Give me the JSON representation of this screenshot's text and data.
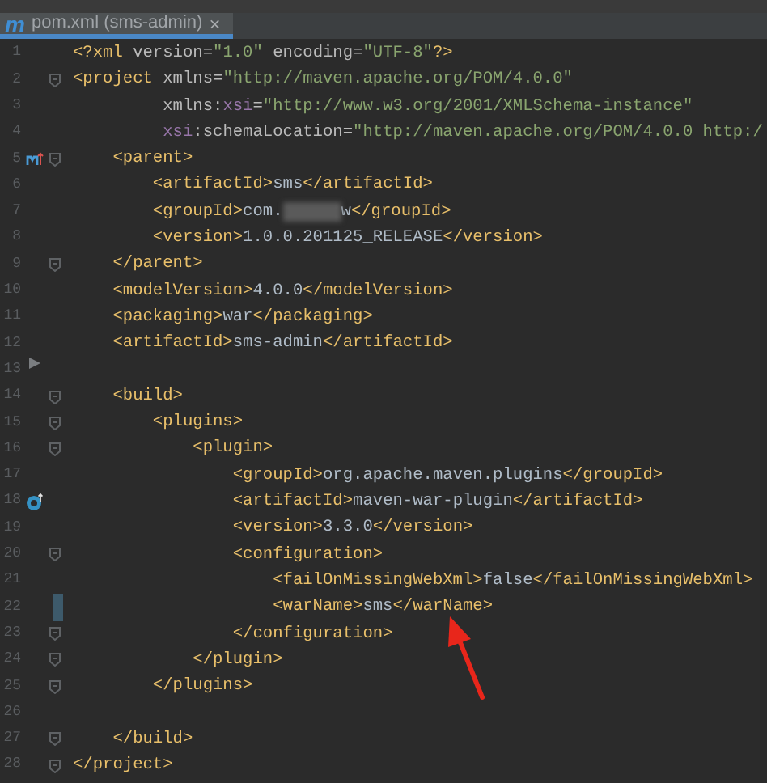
{
  "tab": {
    "icon_letter": "m",
    "title": "pom.xml (sms-admin)",
    "close": "×",
    "selected": true
  },
  "lines": [
    {
      "number": "1",
      "fold": false,
      "tokens": [
        {
          "kind": "tag",
          "text": "<?xml "
        },
        {
          "kind": "attr",
          "text": "version="
        },
        {
          "kind": "value",
          "text": "\"1.0\""
        },
        {
          "kind": "attr",
          "text": " encoding="
        },
        {
          "kind": "value",
          "text": "\"UTF-8\""
        },
        {
          "kind": "tag",
          "text": "?>"
        }
      ]
    },
    {
      "number": "2",
      "fold": true,
      "tokens": [
        {
          "kind": "tag",
          "text": "<project "
        },
        {
          "kind": "attr",
          "text": "xmlns="
        },
        {
          "kind": "value",
          "text": "\"http://maven.apache.org/POM/4.0.0\""
        }
      ]
    },
    {
      "number": "3",
      "fold": false,
      "tokens": [
        {
          "kind": "attr",
          "text": "         xmlns:"
        },
        {
          "kind": "ns",
          "text": "xsi"
        },
        {
          "kind": "attr",
          "text": "="
        },
        {
          "kind": "value",
          "text": "\"http://www.w3.org/2001/XMLSchema-instance\""
        }
      ]
    },
    {
      "number": "4",
      "fold": false,
      "tokens": [
        {
          "kind": "ns",
          "text": "         xsi"
        },
        {
          "kind": "attr",
          "text": ":schemaLocation="
        },
        {
          "kind": "value",
          "text": "\"http://maven.apache.org/POM/4.0.0 http:/"
        }
      ]
    },
    {
      "number": "5",
      "fold": true,
      "gutter_icon": {
        "kind": "maven"
      },
      "tokens": [
        {
          "kind": "tag",
          "text": "    <parent>"
        }
      ]
    },
    {
      "number": "6",
      "fold": false,
      "tokens": [
        {
          "kind": "tag",
          "text": "        <artifactId>"
        },
        {
          "kind": "text",
          "text": "sms"
        },
        {
          "kind": "tag",
          "text": "</artifactId>"
        }
      ]
    },
    {
      "number": "7",
      "fold": false,
      "tokens": [
        {
          "kind": "tag",
          "text": "        <groupId>"
        },
        {
          "kind": "text",
          "text": "com."
        },
        {
          "kind": "redacted"
        },
        {
          "kind": "text",
          "text": "w"
        },
        {
          "kind": "tag",
          "text": "</groupId>"
        }
      ]
    },
    {
      "number": "8",
      "fold": false,
      "tokens": [
        {
          "kind": "tag",
          "text": "        <version>"
        },
        {
          "kind": "text",
          "text": "1.0.0.201125_RELEASE"
        },
        {
          "kind": "tag",
          "text": "</version>"
        }
      ]
    },
    {
      "number": "9",
      "fold": true,
      "tokens": [
        {
          "kind": "tag",
          "text": "    </parent>"
        }
      ]
    },
    {
      "number": "10",
      "fold": false,
      "tokens": [
        {
          "kind": "tag",
          "text": "    <modelVersion>"
        },
        {
          "kind": "text",
          "text": "4.0.0"
        },
        {
          "kind": "tag",
          "text": "</modelVersion>"
        }
      ]
    },
    {
      "number": "11",
      "fold": false,
      "tokens": [
        {
          "kind": "tag",
          "text": "    <packaging>"
        },
        {
          "kind": "text",
          "text": "war"
        },
        {
          "kind": "tag",
          "text": "</packaging>"
        }
      ]
    },
    {
      "number": "12",
      "fold": false,
      "tokens": [
        {
          "kind": "tag",
          "text": "    <artifactId>"
        },
        {
          "kind": "text",
          "text": "sms-admin"
        },
        {
          "kind": "tag",
          "text": "</artifactId>"
        }
      ]
    },
    {
      "number": "13",
      "fold": false,
      "gutter_icon": {
        "kind": "run"
      }
    },
    {
      "number": "14",
      "fold": true,
      "tokens": [
        {
          "kind": "tag",
          "text": "    <build>"
        }
      ]
    },
    {
      "number": "15",
      "fold": true,
      "tokens": [
        {
          "kind": "tag",
          "text": "        <plugins>"
        }
      ]
    },
    {
      "number": "16",
      "fold": true,
      "tokens": [
        {
          "kind": "tag",
          "text": "            <plugin>"
        }
      ]
    },
    {
      "number": "17",
      "fold": false,
      "tokens": [
        {
          "kind": "tag",
          "text": "                <groupId>"
        },
        {
          "kind": "text",
          "text": "org.apache.maven.plugins"
        },
        {
          "kind": "tag",
          "text": "</groupId>"
        }
      ]
    },
    {
      "number": "18",
      "fold": false,
      "gutter_icon": {
        "kind": "override"
      },
      "tokens": [
        {
          "kind": "tag",
          "text": "                <artifactId>"
        },
        {
          "kind": "text",
          "text": "maven-war-plugin"
        },
        {
          "kind": "tag",
          "text": "</artifactId>"
        }
      ]
    },
    {
      "number": "19",
      "fold": false,
      "tokens": [
        {
          "kind": "tag",
          "text": "                <version>"
        },
        {
          "kind": "text",
          "text": "3.3.0"
        },
        {
          "kind": "tag",
          "text": "</version>"
        }
      ]
    },
    {
      "number": "20",
      "fold": true,
      "tokens": [
        {
          "kind": "tag",
          "text": "                <configuration>"
        }
      ]
    },
    {
      "number": "21",
      "fold": false,
      "tokens": [
        {
          "kind": "tag",
          "text": "                    <failOnMissingWebXml>"
        },
        {
          "kind": "text",
          "text": "false"
        },
        {
          "kind": "tag",
          "text": "</failOnMissingWebXml>"
        }
      ]
    },
    {
      "number": "22",
      "fold": false,
      "gutter_icon": {
        "kind": "change"
      },
      "tokens": [
        {
          "kind": "tag",
          "text": "                    <warName>"
        },
        {
          "kind": "text",
          "text": "sms"
        },
        {
          "kind": "tag",
          "text": "</warName>"
        }
      ]
    },
    {
      "number": "23",
      "fold": true,
      "tokens": [
        {
          "kind": "tag",
          "text": "                </configuration>"
        }
      ]
    },
    {
      "number": "24",
      "fold": true,
      "tokens": [
        {
          "kind": "tag",
          "text": "            </plugin>"
        }
      ]
    },
    {
      "number": "25",
      "fold": true,
      "tokens": [
        {
          "kind": "tag",
          "text": "        </plugins>"
        }
      ]
    },
    {
      "number": "26",
      "fold": false
    },
    {
      "number": "27",
      "fold": true,
      "tokens": [
        {
          "kind": "tag",
          "text": "    </build>"
        }
      ]
    },
    {
      "number": "28",
      "fold": true,
      "tokens": [
        {
          "kind": "tag",
          "text": "</project>"
        }
      ]
    }
  ]
}
